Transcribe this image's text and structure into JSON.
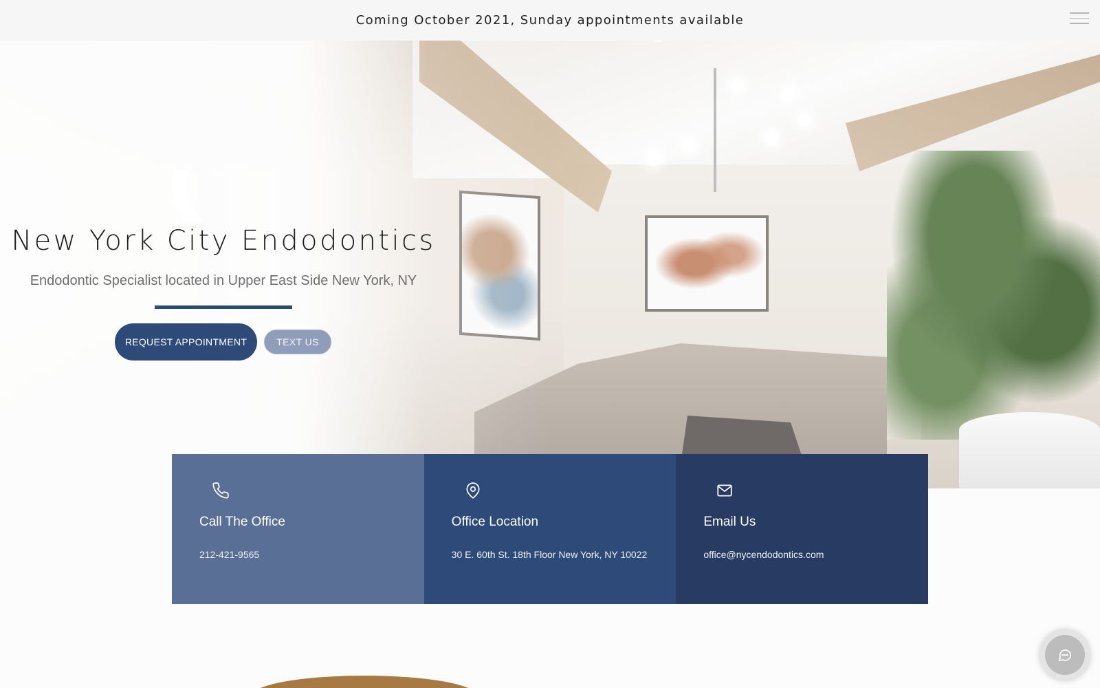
{
  "announcement": {
    "text": "Coming October 2021, Sunday appointments available"
  },
  "hero": {
    "title": "New York City Endodontics",
    "subtitle": "Endodontic Specialist located in Upper East Side New York, NY",
    "request_button": "REQUEST APPOINTMENT",
    "text_button": "TEXT US"
  },
  "cards": [
    {
      "icon": "phone-icon",
      "title": "Call The Office",
      "value": "212-421-9565"
    },
    {
      "icon": "location-pin-icon",
      "title": "Office Location",
      "value": "30 E. 60th St. 18th Floor New York, NY 10022"
    },
    {
      "icon": "mail-icon",
      "title": "Email Us",
      "value": "office@nycendodontics.com"
    }
  ],
  "colors": {
    "brand_navy": "#2e4a78",
    "card_light": "#5a6f96",
    "card_mid": "#2e4a78",
    "card_dark": "#283b63",
    "text_button": "#8f9dbb"
  },
  "widgets": {
    "menu_icon": "hamburger-menu-icon",
    "chat_icon": "chat-bubble-icon"
  }
}
